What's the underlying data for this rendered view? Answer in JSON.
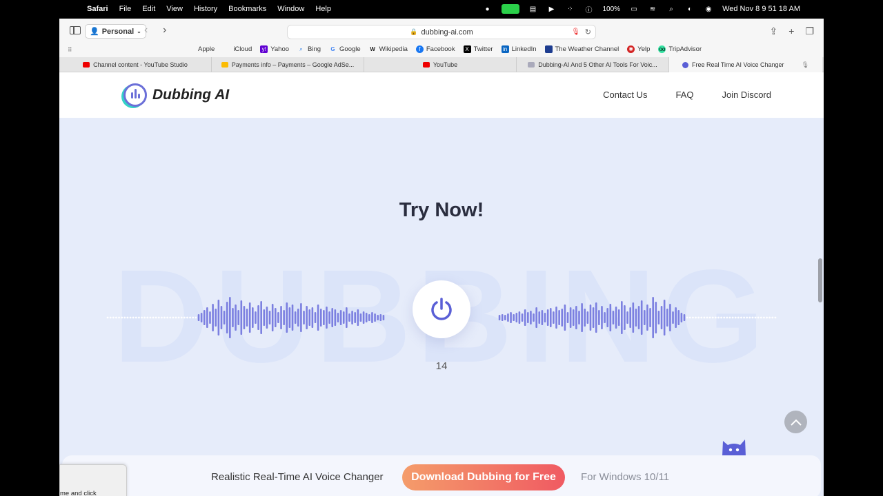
{
  "menubar": {
    "app": "Safari",
    "items": [
      "File",
      "Edit",
      "View",
      "History",
      "Bookmarks",
      "Window",
      "Help"
    ],
    "battery": "100%",
    "clock": "Wed Nov 8  9 51 18 AM"
  },
  "toolbar": {
    "profile": "Personal",
    "url": "dubbing-ai.com"
  },
  "favorites": [
    "Apple",
    "iCloud",
    "Yahoo",
    "Bing",
    "Google",
    "Wikipedia",
    "Facebook",
    "Twitter",
    "LinkedIn",
    "The Weather Channel",
    "Yelp",
    "TripAdvisor"
  ],
  "tabs": [
    {
      "label": "Channel content - YouTube Studio",
      "active": false
    },
    {
      "label": "Payments info – Payments – Google AdSe...",
      "active": false
    },
    {
      "label": "YouTube",
      "active": false
    },
    {
      "label": "Dubbing-AI And 5 Other AI Tools For Voic...",
      "active": false
    },
    {
      "label": "Free Real Time AI Voice Changer",
      "active": true
    }
  ],
  "site": {
    "brand": "Dubbing AI",
    "nav": [
      "Contact Us",
      "FAQ",
      "Join Discord"
    ],
    "hero_title": "Try Now!",
    "watermark": "DUBBING",
    "counter": "14",
    "bottom_text": "Realistic Real-Time AI Voice Changer",
    "download_label": "Download Dubbing for Free",
    "os_text": "For Windows 10/11",
    "accent": "#5a5fd6"
  },
  "popup": {
    "text": "me and click"
  }
}
